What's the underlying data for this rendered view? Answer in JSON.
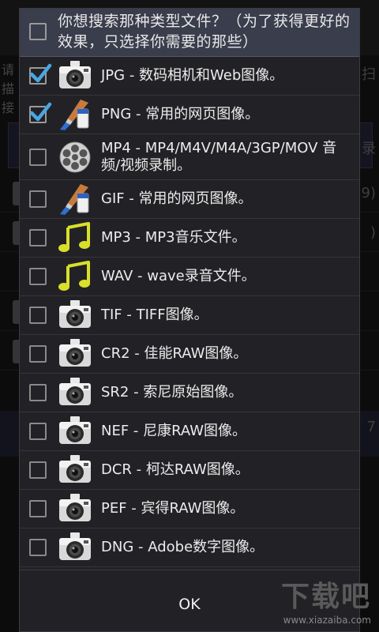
{
  "background": {
    "line1": "请",
    "line2": "描",
    "line3": "接",
    "right1": "扫",
    "right_search": "录",
    "right_row1": "9)",
    "right_row2": ")",
    "right_sel": "7"
  },
  "dialog": {
    "title": "你想搜索那种类型文件？（为了获得更好的效果，只选择你需要的那些）",
    "items": [
      {
        "label": "JPG - 数码相机和Web图像。",
        "checked": true,
        "icon": "camera-icon"
      },
      {
        "label": "PNG - 常用的网页图像。",
        "checked": true,
        "icon": "paint-brush-icon"
      },
      {
        "label": "MP4 - MP4/M4V/M4A/3GP/MOV 音频/视频录制。",
        "checked": false,
        "icon": "film-reel-icon"
      },
      {
        "label": "GIF - 常用的网页图像。",
        "checked": false,
        "icon": "paint-brush-icon"
      },
      {
        "label": "MP3 - MP3音乐文件。",
        "checked": false,
        "icon": "music-note-icon"
      },
      {
        "label": "WAV - wave录音文件。",
        "checked": false,
        "icon": "music-note-icon"
      },
      {
        "label": "TIF - TIFF图像。",
        "checked": false,
        "icon": "camera-icon"
      },
      {
        "label": "CR2 - 佳能RAW图像。",
        "checked": false,
        "icon": "camera-icon"
      },
      {
        "label": "SR2 - 索尼原始图像。",
        "checked": false,
        "icon": "camera-icon"
      },
      {
        "label": "NEF - 尼康RAW图像。",
        "checked": false,
        "icon": "camera-icon"
      },
      {
        "label": "DCR - 柯达RAW图像。",
        "checked": false,
        "icon": "camera-icon"
      },
      {
        "label": "PEF - 宾得RAW图像。",
        "checked": false,
        "icon": "camera-icon"
      },
      {
        "label": "DNG - Adobe数字图像。",
        "checked": false,
        "icon": "camera-icon"
      }
    ],
    "ok_label": "OK"
  },
  "watermark": {
    "brand": "下载吧",
    "url": "www.xiazaiba.com"
  },
  "colors": {
    "dialog_bg": "#222226",
    "header_bg": "#3a3d4c",
    "check_accent": "#4aa6e0"
  }
}
